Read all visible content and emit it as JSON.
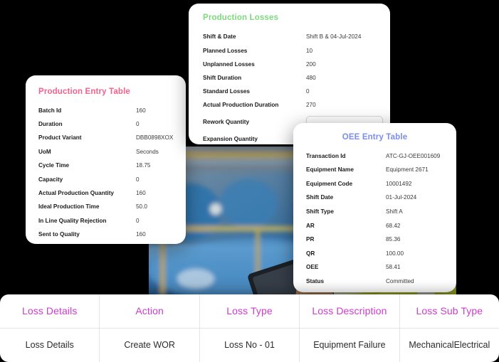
{
  "background_color": "#000000",
  "photo": {
    "alt": "industrial worker in yellow hard hat and hi-vis jacket holding a tablet in a plant"
  },
  "production_entry_table": {
    "title": "Production Entry Table",
    "title_color": "#f2638c",
    "rows": [
      {
        "label": "Batch Id",
        "value": "160"
      },
      {
        "label": "Duration",
        "value": "0"
      },
      {
        "label": "Product Variant",
        "value": "DBB0898XOX"
      },
      {
        "label": "UoM",
        "value": "Seconds"
      },
      {
        "label": "Cycle Time",
        "value": "18.75"
      },
      {
        "label": "Capacity",
        "value": "0"
      },
      {
        "label": "Actual Production Quantity",
        "value": "160"
      },
      {
        "label": "Ideal Production Time",
        "value": "50.0"
      },
      {
        "label": "In Line Quality Rejection",
        "value": "0"
      },
      {
        "label": "Sent to Quality",
        "value": "160"
      }
    ]
  },
  "production_losses": {
    "title": "Production Losses",
    "title_color": "#7ed97e",
    "rows": [
      {
        "label": "Shift & Date",
        "value": "Shift B & 04-Jul-2024"
      },
      {
        "label": "Planned Losses",
        "value": "10"
      },
      {
        "label": "Unplanned Losses",
        "value": "200"
      },
      {
        "label": "Shift Duration",
        "value": "480"
      },
      {
        "label": "Standard Losses",
        "value": "0"
      },
      {
        "label": "Actual Production Duration",
        "value": "270"
      }
    ],
    "rework_quantity": {
      "label": "Rework Quantity",
      "value": "",
      "placeholder": ""
    },
    "expansion_quantity": {
      "label": "Expansion Quantity",
      "value": ""
    }
  },
  "oee_entry_table": {
    "title": "OEE Entry Table",
    "title_color": "#7b8cf4",
    "rows": [
      {
        "label": "Transaction Id",
        "value": "ATC-GJ-OEE001609"
      },
      {
        "label": "Equipment Name",
        "value": "Equipment 2671"
      },
      {
        "label": "Equipment Code",
        "value": "10001492"
      },
      {
        "label": "Shift Date",
        "value": "01-Jul-2024"
      },
      {
        "label": "Shift Type",
        "value": "Shift A"
      },
      {
        "label": "AR",
        "value": "68.42"
      },
      {
        "label": "PR",
        "value": "85.36"
      },
      {
        "label": "QR",
        "value": "100.00"
      },
      {
        "label": "OEE",
        "value": "58.41"
      },
      {
        "label": "Status",
        "value": "Committed"
      }
    ]
  },
  "loss_table": {
    "header_color": "#cc3ccc",
    "columns": [
      "Loss Details",
      "Action",
      "Loss Type",
      "Loss Description",
      "Loss Sub Type"
    ],
    "rows": [
      [
        "Loss Details",
        "Create WOR",
        "Loss No - 01",
        "Equipment Failure",
        "Mechanical\nElectrical"
      ]
    ]
  }
}
